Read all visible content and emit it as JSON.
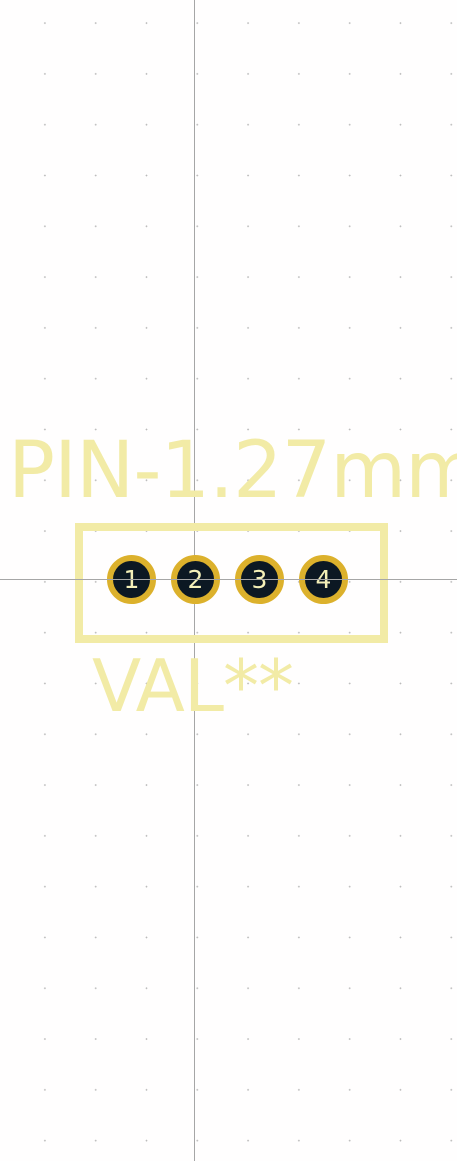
{
  "footprint": {
    "reference": "PIN-1.27mm",
    "value": "VAL**",
    "pads": [
      "1",
      "2",
      "3",
      "4"
    ]
  },
  "colors": {
    "background": "#fffefe",
    "silkscreen": "#f2eba6",
    "pad_ring": "#dcb12c",
    "pad_hole": "#0c1823",
    "pad_number": "#f4f0b8",
    "crosshair": "#a6a6a6",
    "grid_dot": "#b9b9b9"
  }
}
